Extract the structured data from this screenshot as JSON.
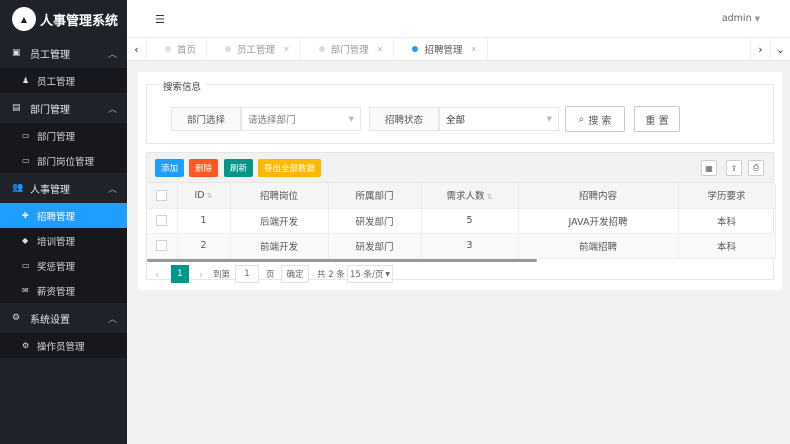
{
  "app": {
    "logo_mark": "ADMIN",
    "title": "人事管理系统"
  },
  "header": {
    "user": "admin"
  },
  "sidebar": {
    "groups": [
      {
        "label": "员工管理",
        "items": [
          "员工管理"
        ]
      },
      {
        "label": "部门管理",
        "items": [
          "部门管理",
          "部门岗位管理"
        ]
      },
      {
        "label": "人事管理",
        "items": [
          "招聘管理",
          "培训管理",
          "奖惩管理",
          "薪资管理"
        ]
      },
      {
        "label": "系统设置",
        "items": [
          "操作员管理"
        ]
      }
    ]
  },
  "tabs": [
    {
      "label": "首页",
      "active": false
    },
    {
      "label": "员工管理",
      "active": false
    },
    {
      "label": "部门管理",
      "active": false
    },
    {
      "label": "招聘管理",
      "active": true
    }
  ],
  "search": {
    "legend": "搜索信息",
    "dept_label": "部门选择",
    "dept_placeholder": "请选择部门",
    "status_label": "招聘状态",
    "status_value": "全部",
    "search_btn": "搜 索",
    "reset_btn": "重 置"
  },
  "toolbar": {
    "add": "添加",
    "delete": "删除",
    "refresh": "刷新",
    "export": "导出全部数据",
    "colors": {
      "add": "#1e9fff",
      "delete": "#ff5722",
      "refresh": "#009688",
      "export": "#ffb800"
    }
  },
  "table": {
    "headers": [
      "ID",
      "招聘岗位",
      "所属部门",
      "需求人数",
      "招聘内容",
      "学历要求"
    ],
    "rows": [
      [
        "1",
        "后端开发",
        "研发部门",
        "5",
        "JAVA开发招聘",
        "本科"
      ],
      [
        "2",
        "前端开发",
        "研发部门",
        "3",
        "前端招聘",
        "本科"
      ]
    ]
  },
  "pager": {
    "current": "1",
    "goto_label": "到第",
    "goto_value": "1",
    "page_unit": "页",
    "confirm": "确定",
    "total": "共 2 条",
    "page_size": "15 条/页"
  }
}
